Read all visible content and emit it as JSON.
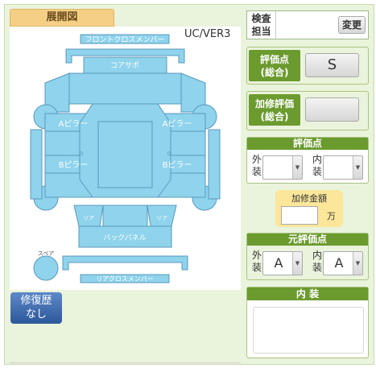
{
  "tab": {
    "label": "展開図"
  },
  "diagram": {
    "version": "UC/VER3",
    "labels": {
      "front_cross_member": "フロントクロスメンバー",
      "core_support": "コアサポ",
      "a_pillar_left": "Aピラー",
      "a_pillar_right": "Aピラー",
      "b_pillar_left": "Bピラー",
      "b_pillar_right": "Bピラー",
      "rear_left": "リア",
      "rear_right": "リア",
      "back_panel": "バックパネル",
      "rear_cross_member": "リアクロスメンバー",
      "spare": "スペア",
      "num_left": "0",
      "num_right": "0"
    },
    "colors": {
      "fill": "#8fd3ec",
      "stroke": "#5b98bd",
      "text": "#ffffff"
    }
  },
  "repair_button": {
    "line1": "修復歴",
    "line2": "なし"
  },
  "inspector": {
    "label_line1": "検査",
    "label_line2": "担当",
    "change_label": "変更"
  },
  "overall_score": {
    "label_line1": "評価点",
    "label_line2": "(総合)",
    "value": "S"
  },
  "repair_score": {
    "label_line1": "加修評価",
    "label_line2": "(総合)",
    "value": ""
  },
  "eval_points": {
    "title": "評価点",
    "exterior_label_1": "外",
    "exterior_label_2": "装",
    "exterior_value": "",
    "interior_label_1": "内",
    "interior_label_2": "装",
    "interior_value": ""
  },
  "repair_amount": {
    "title": "加修金額",
    "value": "",
    "unit": "万"
  },
  "original_eval": {
    "title": "元評価点",
    "exterior_label_1": "外",
    "exterior_label_2": "装",
    "exterior_value": "A",
    "interior_label_1": "内",
    "interior_label_2": "装",
    "interior_value": "A"
  },
  "interior": {
    "title": "内 装",
    "value": ""
  },
  "arrow_glyph": "▼"
}
